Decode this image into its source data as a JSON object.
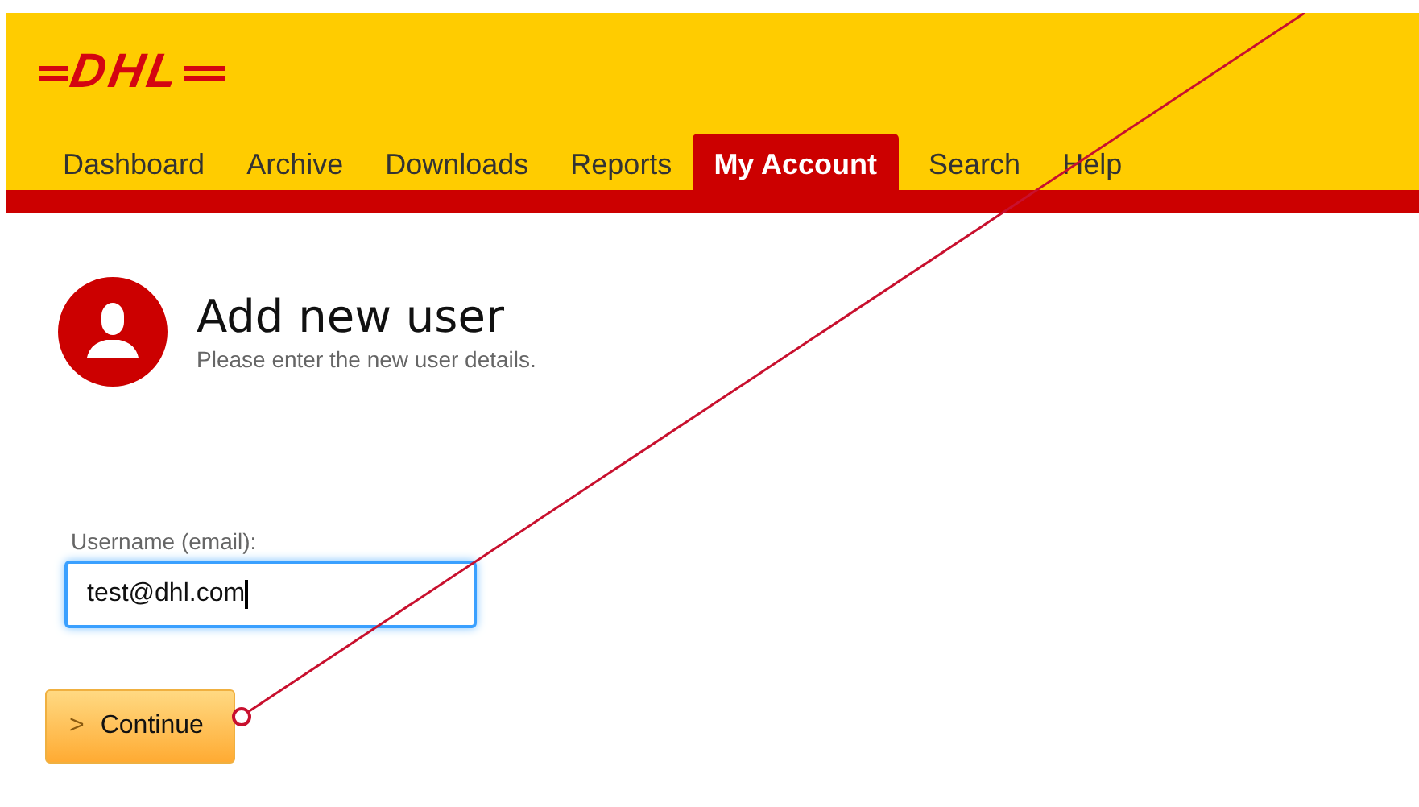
{
  "header": {
    "logo": "DHL"
  },
  "nav": [
    {
      "label": "Dashboard",
      "selected": false
    },
    {
      "label": "Archive",
      "selected": false
    },
    {
      "label": "Downloads",
      "selected": false
    },
    {
      "label": "Reports",
      "selected": false
    },
    {
      "label": "My Account",
      "selected": true
    },
    {
      "label": "Search",
      "selected": false
    },
    {
      "label": "Help",
      "selected": false
    }
  ],
  "page": {
    "title": "Add new user",
    "subtitle": "Please enter the new user details."
  },
  "form": {
    "label": "Username (email):",
    "value": "test@dhl.com",
    "focused": true
  },
  "button": {
    "icon": ">",
    "label": "Continue"
  }
}
